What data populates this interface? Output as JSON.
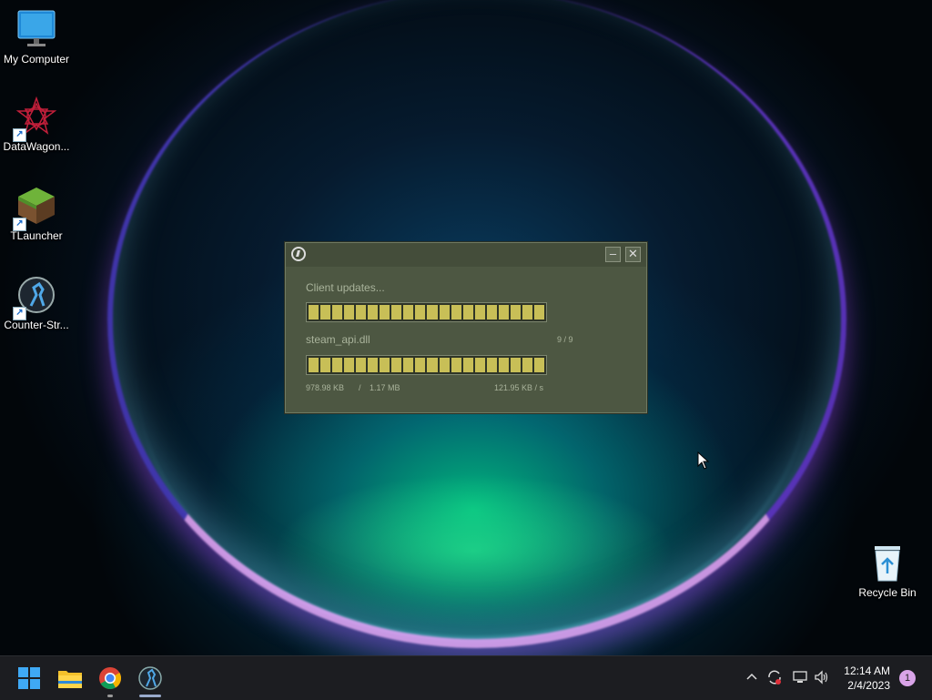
{
  "desktop": {
    "icons": [
      {
        "label": "My Computer",
        "icon": "monitor-icon"
      },
      {
        "label": "DataWagon...",
        "icon": "datawagon-icon"
      },
      {
        "label": "TLauncher",
        "icon": "minecraft-block-icon"
      },
      {
        "label": "Counter-Str...",
        "icon": "counter-strike-icon"
      },
      {
        "label": "Recycle Bin",
        "icon": "recycle-bin-icon"
      }
    ]
  },
  "updater": {
    "status": "Client updates...",
    "file_name": "steam_api.dll",
    "file_count": "9 / 9",
    "downloaded": "978.98 KB",
    "separator": "/",
    "total": "1.17 MB",
    "speed": "121.95 KB / s",
    "overall_progress": 1.0,
    "file_progress": 1.0,
    "bar_color": "#c8bf57"
  },
  "taskbar": {
    "apps": [
      "start-icon",
      "file-explorer-icon",
      "chrome-icon",
      "counter-strike-icon"
    ],
    "tray": [
      "chevron-up-icon",
      "sync-icon",
      "network-icon",
      "volume-icon"
    ],
    "time": "12:14 AM",
    "date": "2/4/2023",
    "notification_count": "1"
  }
}
